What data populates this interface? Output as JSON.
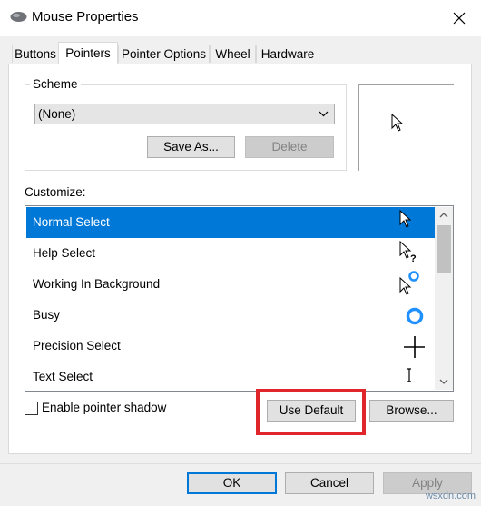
{
  "window": {
    "title": "Mouse Properties",
    "icons": {
      "app": "mouse-icon",
      "close": "close-icon"
    }
  },
  "tabs": [
    {
      "label": "Buttons",
      "active": false
    },
    {
      "label": "Pointers",
      "active": true
    },
    {
      "label": "Pointer Options",
      "active": false
    },
    {
      "label": "Wheel",
      "active": false
    },
    {
      "label": "Hardware",
      "active": false
    }
  ],
  "scheme": {
    "group_label": "Scheme",
    "selected": "(None)",
    "save_as_label": "Save As...",
    "delete_label": "Delete"
  },
  "customize": {
    "label": "Customize:",
    "items": [
      {
        "label": "Normal Select",
        "icon": "arrow-cursor-icon",
        "selected": true
      },
      {
        "label": "Help Select",
        "icon": "help-cursor-icon",
        "selected": false
      },
      {
        "label": "Working In Background",
        "icon": "working-cursor-icon",
        "selected": false
      },
      {
        "label": "Busy",
        "icon": "busy-ring-icon",
        "selected": false
      },
      {
        "label": "Precision Select",
        "icon": "crosshair-icon",
        "selected": false
      },
      {
        "label": "Text Select",
        "icon": "ibeam-icon",
        "selected": false
      }
    ]
  },
  "options": {
    "shadow_label": "Enable pointer shadow",
    "shadow_checked": false,
    "use_default_label": "Use Default",
    "browse_label": "Browse..."
  },
  "footer": {
    "ok_label": "OK",
    "cancel_label": "Cancel",
    "apply_label": "Apply"
  },
  "watermark": "wsxdn.com",
  "colors": {
    "accent": "#0078d7",
    "highlight": "#e0262b"
  }
}
